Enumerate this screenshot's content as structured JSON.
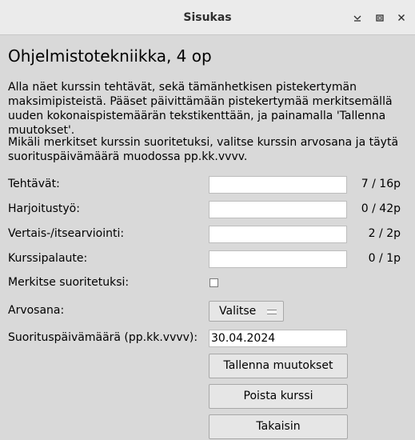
{
  "window": {
    "title": "Sisukas",
    "controls": {
      "minimize_icon": "chevron-down-icon",
      "maximize_icon": "maximize-icon",
      "close_icon": "close-icon"
    }
  },
  "course": {
    "heading": "Ohjelmistotekniikka, 4 op",
    "intro": "Alla näet kurssin tehtävät, sekä tämänhetkisen pistekertymän maksimipisteistä. Pääset päivittämään pistekertymää merkitsemällä uuden kokonaispistemäärän tekstikenttään, ja painamalla 'Tallenna muutokset'.",
    "completion_info": "Mikäli merkitset kurssin suoritetuksi, valitse kurssin arvosana ja täytä suorituspäivämäärä muodossa pp.kk.vvvv."
  },
  "form": {
    "tasks": [
      {
        "label": "Tehtävät:",
        "value": "",
        "points": "7 / 16p"
      },
      {
        "label": "Harjoitustyö:",
        "value": "",
        "points": "0 / 42p"
      },
      {
        "label": "Vertais-/itsearviointi:",
        "value": "",
        "points": "2 / 2p"
      },
      {
        "label": "Kurssipalaute:",
        "value": "",
        "points": "0 / 1p"
      }
    ],
    "completed_label": "Merkitse suoritetuksi:",
    "completed_checked": false,
    "grade_label": "Arvosana:",
    "grade_selected": "Valitse",
    "date_label": "Suorituspäivämäärä (pp.kk.vvvv):",
    "date_value": "30.04.2024"
  },
  "buttons": {
    "save": "Tallenna muutokset",
    "delete": "Poista kurssi",
    "back": "Takaisin"
  }
}
